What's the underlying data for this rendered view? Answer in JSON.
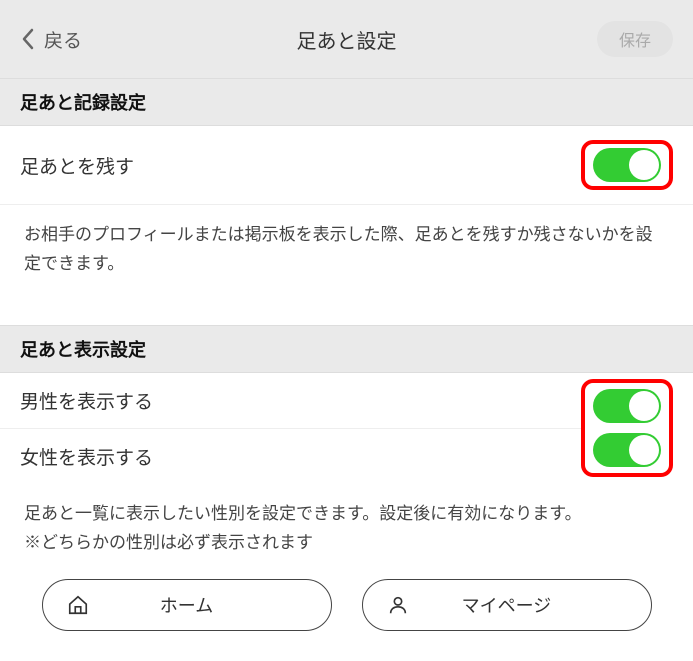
{
  "header": {
    "back_label": "戻る",
    "title": "足あと設定",
    "save_label": "保存"
  },
  "section1": {
    "header": "足あと記録設定",
    "row1_label": "足あとを残す",
    "row1_on": true,
    "desc": "お相手のプロフィールまたは掲示板を表示した際、足あとを残すか残さないかを設定できます。"
  },
  "section2": {
    "header": "足あと表示設定",
    "row_male_label": "男性を表示する",
    "row_male_on": true,
    "row_female_label": "女性を表示する",
    "row_female_on": true,
    "desc": "足あと一覧に表示したい性別を設定できます。設定後に有効になります。\n※どちらかの性別は必ず表示されます"
  },
  "nav": {
    "home_label": "ホーム",
    "mypage_label": "マイページ"
  }
}
